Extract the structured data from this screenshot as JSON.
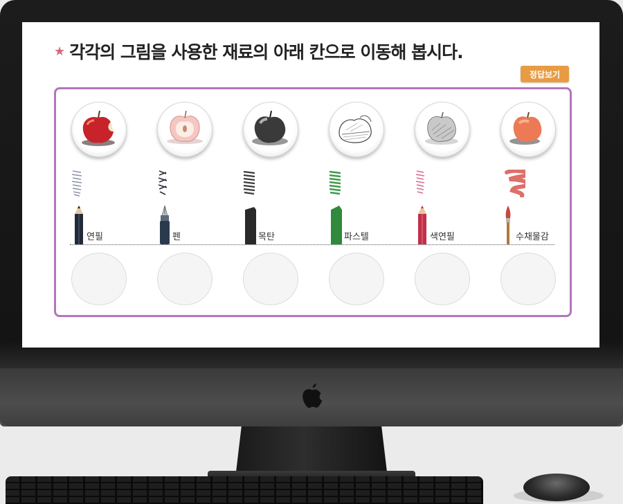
{
  "header": {
    "star_icon": "★",
    "title": "각각의 그림을 사용한 재료의 아래 칸으로 이동해 봅시다.",
    "answer_button_label": "정답보기"
  },
  "artworks": [
    {
      "name": "apple-colored-pencil-image",
      "icon": "red-apple"
    },
    {
      "name": "apple-pen-image",
      "icon": "cut-apple"
    },
    {
      "name": "apple-charcoal-image",
      "icon": "charcoal-apple"
    },
    {
      "name": "apple-sketch-image",
      "icon": "sketch-apple"
    },
    {
      "name": "apple-pencil-image",
      "icon": "pencil-apple"
    },
    {
      "name": "apple-watercolor-image",
      "icon": "watercolor-apple"
    }
  ],
  "materials": [
    {
      "label": "연필",
      "swatch_color": "#8a94a8",
      "tool_color": "#222a38"
    },
    {
      "label": "펜",
      "swatch_color": "#2b2f3a",
      "tool_color": "#2a3a4e"
    },
    {
      "label": "목탄",
      "swatch_color": "#3a3a3a",
      "tool_color": "#2a2a2a"
    },
    {
      "label": "파스텔",
      "swatch_color": "#3f9a4a",
      "tool_color": "#2f8a3c"
    },
    {
      "label": "색연필",
      "swatch_color": "#e07a9a",
      "tool_color": "#c0304a"
    },
    {
      "label": "수채물감",
      "swatch_color": "#d9564f",
      "tool_color": "#b07a3a"
    }
  ],
  "colors": {
    "frame_border": "#b375bd",
    "answer_button": "#e79c43",
    "star": "#d9687e"
  }
}
